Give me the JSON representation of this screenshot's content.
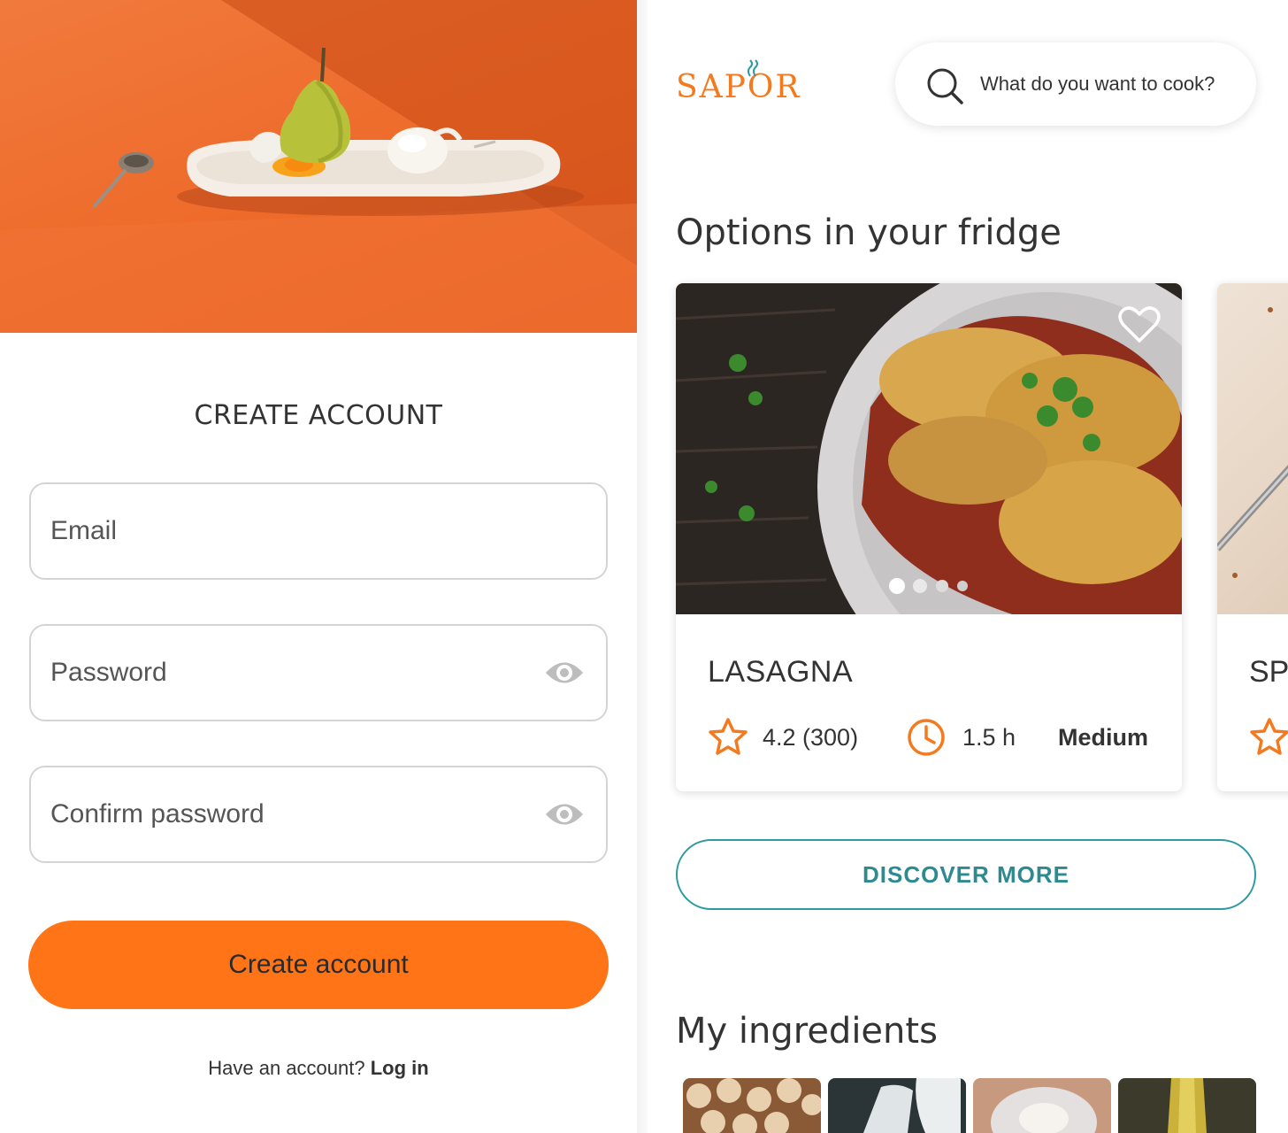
{
  "signup": {
    "title": "CREATE ACCOUNT",
    "email_placeholder": "Email",
    "password_placeholder": "Password",
    "confirm_placeholder": "Confirm password",
    "create_button": "Create account",
    "have_account": "Have an account?",
    "login_link": "Log in"
  },
  "header": {
    "logo": "SAPOR",
    "search_placeholder": "What do you want to cook?"
  },
  "fridge": {
    "title": "Options in your fridge",
    "cards": [
      {
        "name": "LASAGNA",
        "rating": "4.2 (300)",
        "time": "1.5 h",
        "difficulty": "Medium"
      },
      {
        "name": "SP"
      }
    ],
    "discover_button": "DISCOVER MORE"
  },
  "ingredients": {
    "title": "My ingredients",
    "items": [
      "mushrooms-photo",
      "milk-photo",
      "flour-photo",
      "oil-photo"
    ]
  },
  "colors": {
    "accent_orange": "#ff7417",
    "teal": "#2c9aa0",
    "text": "#333333"
  },
  "icons": [
    "search-icon",
    "eye-icon",
    "heart-icon",
    "star-icon",
    "clock-icon",
    "steam-icon"
  ]
}
